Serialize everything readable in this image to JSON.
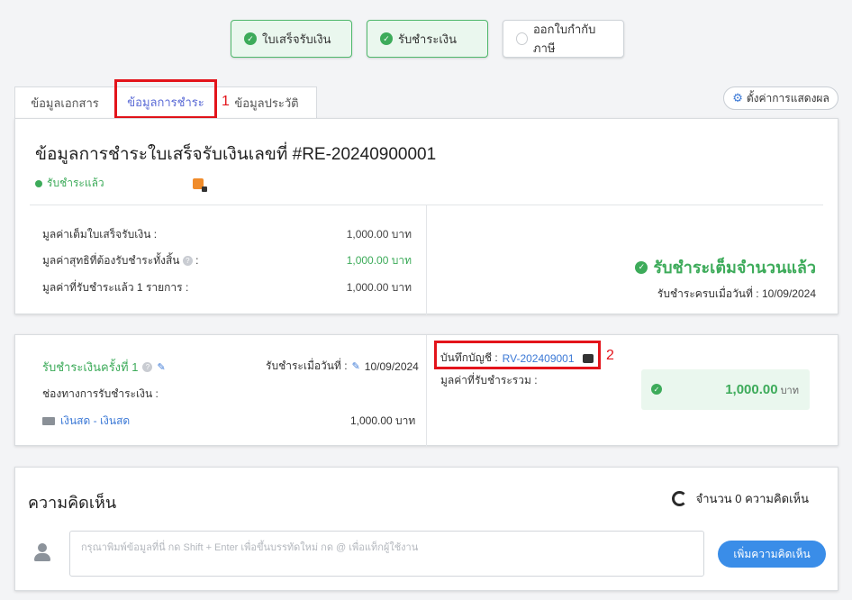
{
  "steps": [
    {
      "label": "ใบเสร็จรับเงิน",
      "status": "done"
    },
    {
      "label": "รับชำระเงิน",
      "status": "done"
    },
    {
      "label": "ออกใบกำกับภาษี",
      "status": "pending"
    }
  ],
  "tabs": [
    {
      "label": "ข้อมูลเอกสาร"
    },
    {
      "label": "ข้อมูลการชำระ"
    },
    {
      "label": "ข้อมูลประวัติ"
    }
  ],
  "annotations": {
    "one": "1",
    "two": "2"
  },
  "settings_label": "ตั้งค่าการแสดงผล",
  "payment_info": {
    "title": "ข้อมูลการชำระใบเสร็จรับเงินเลขที่ #RE-20240900001",
    "status": "รับชำระแล้ว",
    "rows": [
      {
        "label": "มูลค่าเต็มใบเสร็จรับเงิน :",
        "value": "1,000.00 บาท"
      },
      {
        "label": "มูลค่าสุทธิที่ต้องรับชำระทั้งสิ้น",
        "value": "1,000.00 บาท"
      },
      {
        "label": "มูลค่าที่รับชำระแล้ว 1 รายการ :",
        "value": "1,000.00 บาท"
      }
    ],
    "full_paid": "รับชำระเต็มจำนวนแล้ว",
    "full_paid_date_label": "รับชำระครบเมื่อวันที่ :",
    "full_paid_date": "10/09/2024"
  },
  "payment_entry": {
    "title": "รับชำระเงินครั้งที่ 1",
    "date_label": "รับชำระเมื่อวันที่ :",
    "date": "10/09/2024",
    "channel_label": "ช่องทางการรับชำระเงิน :",
    "channel": "เงินสด - เงินสด",
    "channel_amount": "1,000.00 บาท",
    "record_label": "บันทึกบัญชี :",
    "record_no": "RV-202409001",
    "total_label": "มูลค่าที่รับชำระรวม :",
    "total_amount": "1,000.00",
    "total_unit": "บาท"
  },
  "comments": {
    "title": "ความคิดเห็น",
    "count": "จำนวน 0 ความคิดเห็น",
    "placeholder": "กรุณาพิมพ์ข้อมูลที่นี่ กด Shift + Enter เพื่อขึ้นบรรทัดใหม่ กด @ เพื่อแท็กผู้ใช้งาน",
    "add_button": "เพิ่มความคิดเห็น"
  },
  "colors": {
    "accent": "#3dab5a",
    "link": "#3c79d6",
    "highlight": "#e3141b",
    "tab_active": "#5b6bd6"
  }
}
